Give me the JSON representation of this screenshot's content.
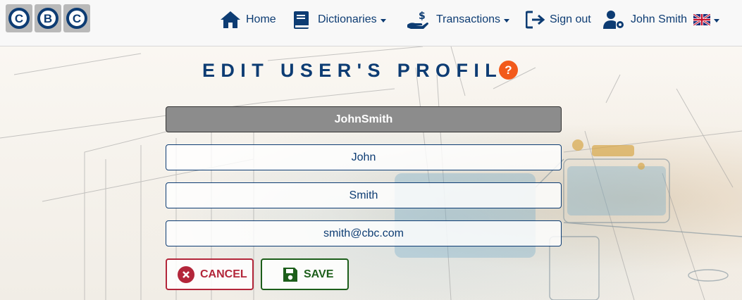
{
  "brand": {
    "logo_letters": [
      "C",
      "B",
      "C"
    ]
  },
  "nav": {
    "home": "Home",
    "dictionaries": "Dictionaries",
    "transactions": "Transactions",
    "sign_out": "Sign out",
    "user": "John Smith",
    "language": "en-GB"
  },
  "page": {
    "title": "EDIT USER'S PROFILE",
    "help": "?"
  },
  "form": {
    "username": "JohnSmith",
    "first_name": "John",
    "last_name": "Smith",
    "email": "smith@cbc.com"
  },
  "buttons": {
    "cancel": "CANCEL",
    "save": "SAVE"
  },
  "colors": {
    "primary": "#0d3c73",
    "help": "#f25a1b",
    "cancel": "#b3263a",
    "save": "#1c5e1a"
  }
}
